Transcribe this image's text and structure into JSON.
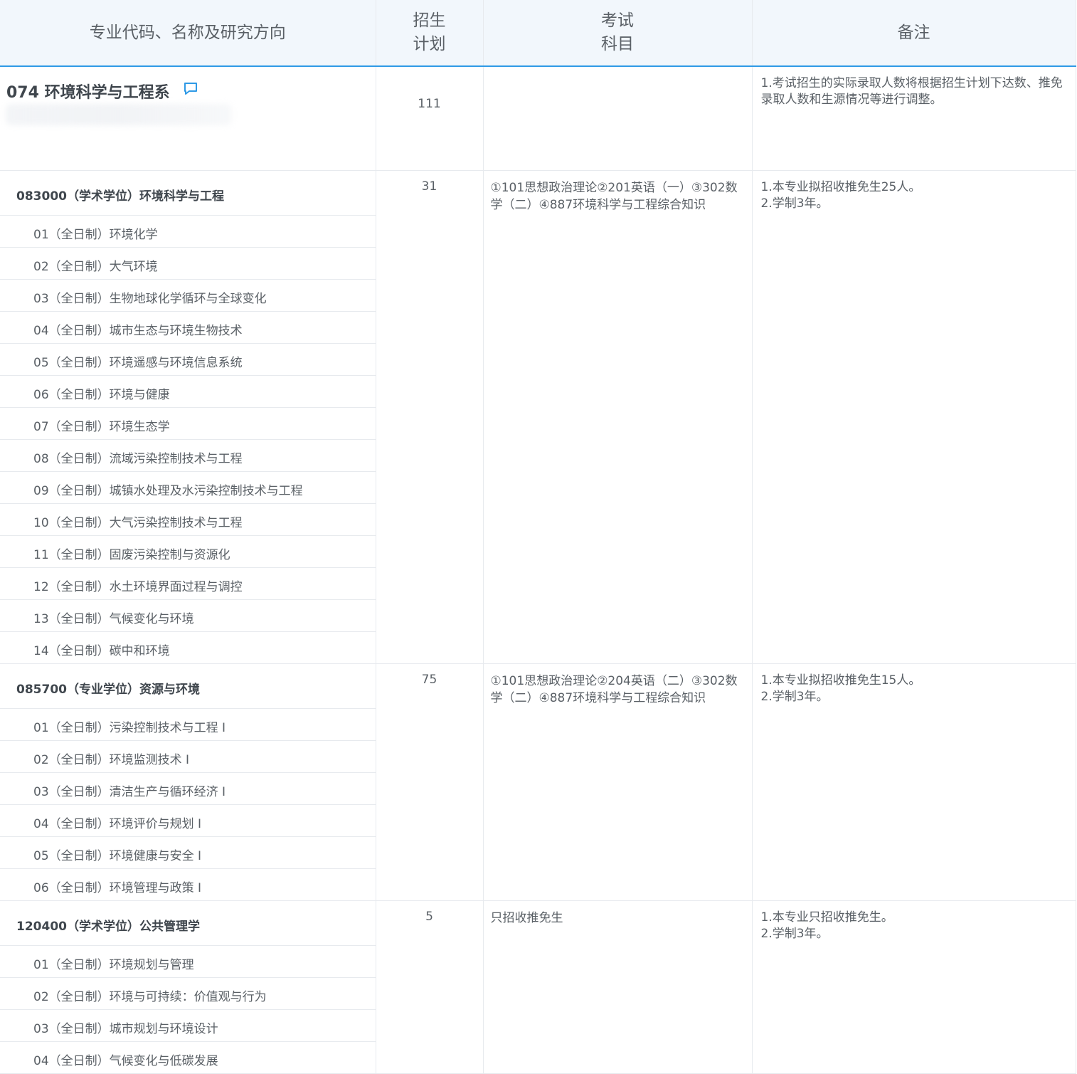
{
  "header": {
    "col1": "专业代码、名称及研究方向",
    "col2_line1": "招生",
    "col2_line2": "计划",
    "col3_line1": "考试",
    "col3_line2": "科目",
    "col4": "备注"
  },
  "department": {
    "title": "074 环境科学与工程系",
    "plan": "111",
    "note_line1": "1.考试招生的实际录取人数将根据招生计划下达数、推免",
    "note_line2": "录取人数和生源情况等进行调整。",
    "icon": "chat-bubble-icon",
    "accent": "#2f9ae6"
  },
  "majors": [
    {
      "name": "083000（学术学位）环境科学与工程",
      "plan": "31",
      "exam_line1": "①101思想政治理论②201英语（一）③302数",
      "exam_line2": "学（二）④887环境科学与工程综合知识",
      "note_line1": "1.本专业拟招收推免生25人。",
      "note_line2": "2.学制3年。",
      "directions": [
        "01（全日制）环境化学",
        "02（全日制）大气环境",
        "03（全日制）生物地球化学循环与全球变化",
        "04（全日制）城市生态与环境生物技术",
        "05（全日制）环境遥感与环境信息系统",
        "06（全日制）环境与健康",
        "07（全日制）环境生态学",
        "08（全日制）流域污染控制技术与工程",
        "09（全日制）城镇水处理及水污染控制技术与工程",
        "10（全日制）大气污染控制技术与工程",
        "11（全日制）固废污染控制与资源化",
        "12（全日制）水土环境界面过程与调控",
        "13（全日制）气候变化与环境",
        "14（全日制）碳中和环境"
      ]
    },
    {
      "name": "085700（专业学位）资源与环境",
      "plan": "75",
      "exam_line1": "①101思想政治理论②204英语（二）③302数",
      "exam_line2": "学（二）④887环境科学与工程综合知识",
      "note_line1": "1.本专业拟招收推免生15人。",
      "note_line2": "2.学制3年。",
      "directions": [
        "01（全日制）污染控制技术与工程 I",
        "02（全日制）环境监测技术 I",
        "03（全日制）清洁生产与循环经济 I",
        "04（全日制）环境评价与规划 I",
        "05（全日制）环境健康与安全 I",
        "06（全日制）环境管理与政策 I"
      ]
    },
    {
      "name": "120400（学术学位）公共管理学",
      "plan": "5",
      "exam_line1": "只招收推免生",
      "exam_line2": "",
      "note_line1": "1.本专业只招收推免生。",
      "note_line2": "2.学制3年。",
      "directions": [
        "01（全日制）环境规划与管理",
        "02（全日制）环境与可持续：价值观与行为",
        "03（全日制）城市规划与环境设计",
        "04（全日制）气候变化与低碳发展"
      ]
    }
  ]
}
